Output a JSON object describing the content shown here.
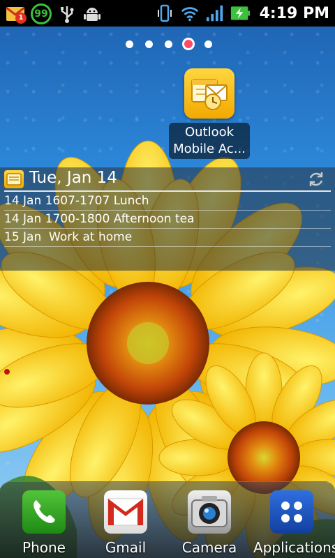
{
  "status_bar": {
    "notification_count": "1",
    "battery_level_text": "99",
    "clock": "4:19 PM",
    "icons": [
      "gmail-notification-icon",
      "battery-percent-icon",
      "usb-icon",
      "android-debug-icon",
      "vibrate-icon",
      "wifi-icon",
      "signal-icon",
      "charging-battery-icon"
    ]
  },
  "home_pages": {
    "count": 5,
    "active_index": 3
  },
  "shortcut": {
    "label": "Outlook\nMobile Ac...",
    "icon": "outlook-calendar-icon"
  },
  "calendar_widget": {
    "date": "Tue, Jan 14",
    "events": [
      "14 Jan 1607-1707 Lunch",
      "14 Jan 1700-1800 Afternoon tea",
      "15 Jan  Work at home"
    ]
  },
  "dock": {
    "phone": "Phone",
    "gmail": "Gmail",
    "camera": "Camera",
    "applications": "Applications"
  },
  "colors": {
    "accent_dot": "#ff4a6b",
    "battery_green": "#3cc23c",
    "outlook_yellow": "#f2a900"
  }
}
